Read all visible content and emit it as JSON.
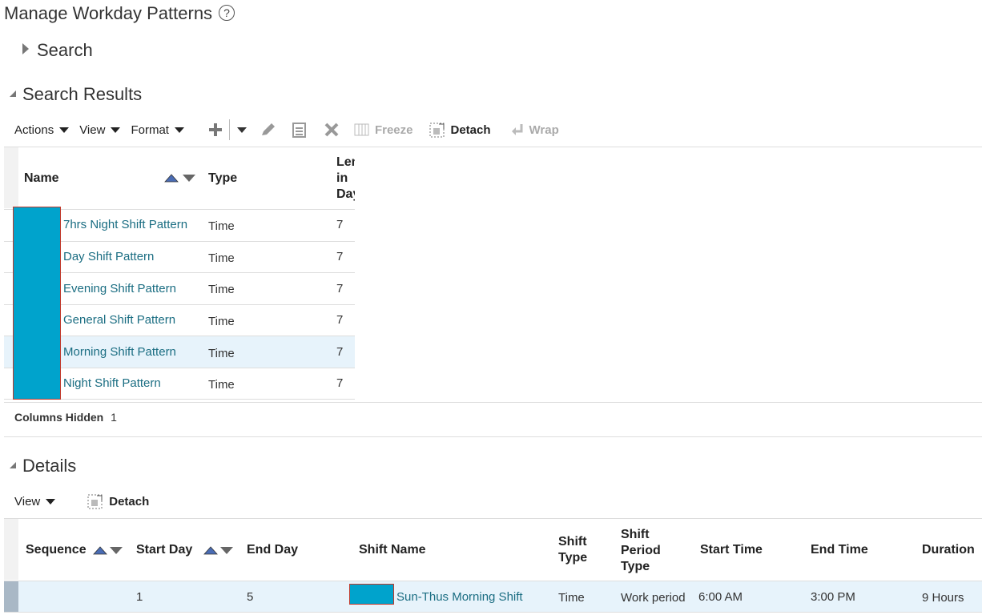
{
  "page": {
    "title": "Manage Workday Patterns",
    "help_icon": "?"
  },
  "search": {
    "label": "Search"
  },
  "results": {
    "label": "Search Results",
    "toolbar": {
      "actions": "Actions",
      "view": "View",
      "format": "Format",
      "freeze": "Freeze",
      "detach": "Detach",
      "wrap": "Wrap"
    },
    "columns": {
      "name": "Name",
      "type": "Type",
      "length_l1": "Len",
      "length_l2": "in",
      "length_l3": "Day"
    },
    "rows": [
      {
        "name": "7hrs Night Shift Pattern",
        "type": "Time",
        "length": "7"
      },
      {
        "name": "Day Shift Pattern",
        "type": "Time",
        "length": "7"
      },
      {
        "name": "Evening Shift Pattern",
        "type": "Time",
        "length": "7"
      },
      {
        "name": "General Shift Pattern",
        "type": "Time",
        "length": "7"
      },
      {
        "name": "Morning Shift Pattern",
        "type": "Time",
        "length": "7"
      },
      {
        "name": "Night Shift Pattern",
        "type": "Time",
        "length": "7"
      }
    ],
    "columns_hidden_label": "Columns Hidden",
    "columns_hidden_count": "1"
  },
  "details": {
    "label": "Details",
    "toolbar": {
      "view": "View",
      "detach": "Detach"
    },
    "columns": {
      "sequence": "Sequence",
      "start_day": "Start Day",
      "end_day": "End Day",
      "shift_name": "Shift Name",
      "shift_type_l1": "Shift",
      "shift_type_l2": "Type",
      "period_l1": "Shift",
      "period_l2": "Period",
      "period_l3": "Type",
      "start_time": "Start Time",
      "end_time": "End Time",
      "duration": "Duration"
    },
    "row": {
      "start_day": "1",
      "end_day": "5",
      "shift_name": "Sun-Thus Morning Shift",
      "shift_type": "Time",
      "period_type": "Work period",
      "start_time": "6:00 AM",
      "end_time": "3:00 PM",
      "duration": "9 Hours"
    }
  },
  "colors": {
    "link": "#1a6d82",
    "selected_row": "#e7f3fb",
    "redaction": "#00a3cc"
  }
}
